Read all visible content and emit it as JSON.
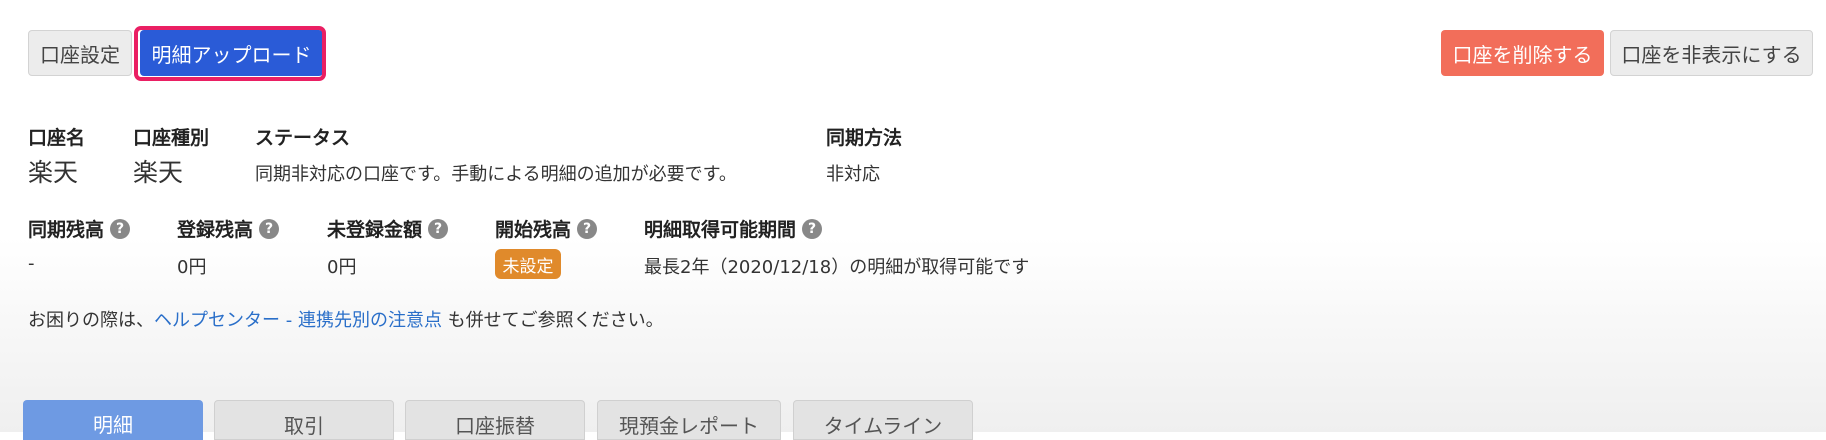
{
  "toolbar": {
    "account_settings": "口座設定",
    "statement_upload": "明細アップロード",
    "delete_account": "口座を削除する",
    "hide_account": "口座を非表示にする"
  },
  "account_info": {
    "name_label": "口座名",
    "name_value": "楽天",
    "type_label": "口座種別",
    "type_value": "楽天",
    "status_label": "ステータス",
    "status_value": "同期非対応の口座です。手動による明細の追加が必要です。",
    "sync_method_label": "同期方法",
    "sync_method_value": "非対応"
  },
  "balances": {
    "synced_balance_label": "同期残高",
    "synced_balance_value": "-",
    "registered_balance_label": "登録残高",
    "registered_balance_value": "0円",
    "unregistered_amount_label": "未登録金額",
    "unregistered_amount_value": "0円",
    "opening_balance_label": "開始残高",
    "opening_balance_badge": "未設定",
    "fetch_period_label": "明細取得可能期間",
    "fetch_period_value": "最長2年（2020/12/18）の明細が取得可能です"
  },
  "help": {
    "prefix": "お困りの際は、",
    "link_helpcenter": "ヘルプセンター",
    "separator": " - ",
    "link_notes": "連携先別の注意点",
    "suffix": " も併せてご参照ください。"
  },
  "tabs": [
    {
      "label": "明細",
      "active": true
    },
    {
      "label": "取引",
      "active": false
    },
    {
      "label": "口座振替",
      "active": false
    },
    {
      "label": "現預金レポート",
      "active": false
    },
    {
      "label": "タイムライン",
      "active": false
    }
  ],
  "colors": {
    "primary_blue": "#2a5bd7",
    "highlight_border": "#ea1f63",
    "danger": "#f26e5a",
    "badge_orange": "#e08a2b",
    "link": "#2a6fc9",
    "active_tab": "#6e9ae3"
  }
}
